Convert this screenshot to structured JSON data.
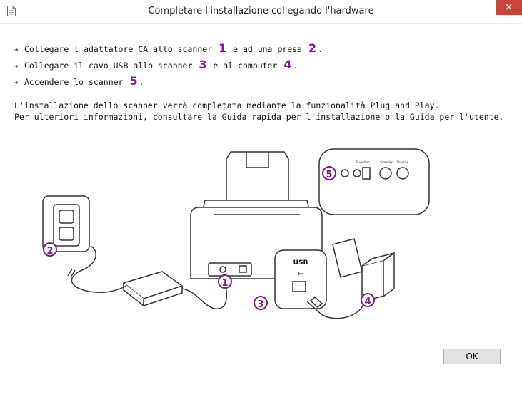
{
  "window": {
    "title": "Completare l'installazione collegando l'hardware",
    "close_glyph": "×",
    "icon": "document-icon"
  },
  "steps": [
    {
      "parts": [
        "Collegare l'adattatore CA allo scanner ",
        "1",
        " e ad una presa ",
        "2",
        "."
      ]
    },
    {
      "parts": [
        "Collegare il cavo USB allo scanner ",
        "3",
        " e al computer ",
        "4",
        "."
      ]
    },
    {
      "parts": [
        "Accendere lo scanner ",
        "5",
        "."
      ]
    }
  ],
  "info": {
    "line1": "L'installazione dello scanner verrà completata mediante la funzionalità Plug and Play.",
    "line2": "Per ulteriori informazioni, consultare la Guida rapida per l'installazione o la Guida per l'utente."
  },
  "diagram": {
    "callouts": [
      "1",
      "2",
      "3",
      "4",
      "5"
    ],
    "usb_label": "USB",
    "function_label": "Function",
    "simplex_label": "Simplex",
    "duplex_label": "Duplex"
  },
  "buttons": {
    "ok_label": "OK"
  },
  "colors": {
    "accent": "#7a1f8c",
    "close": "#c7463a"
  }
}
